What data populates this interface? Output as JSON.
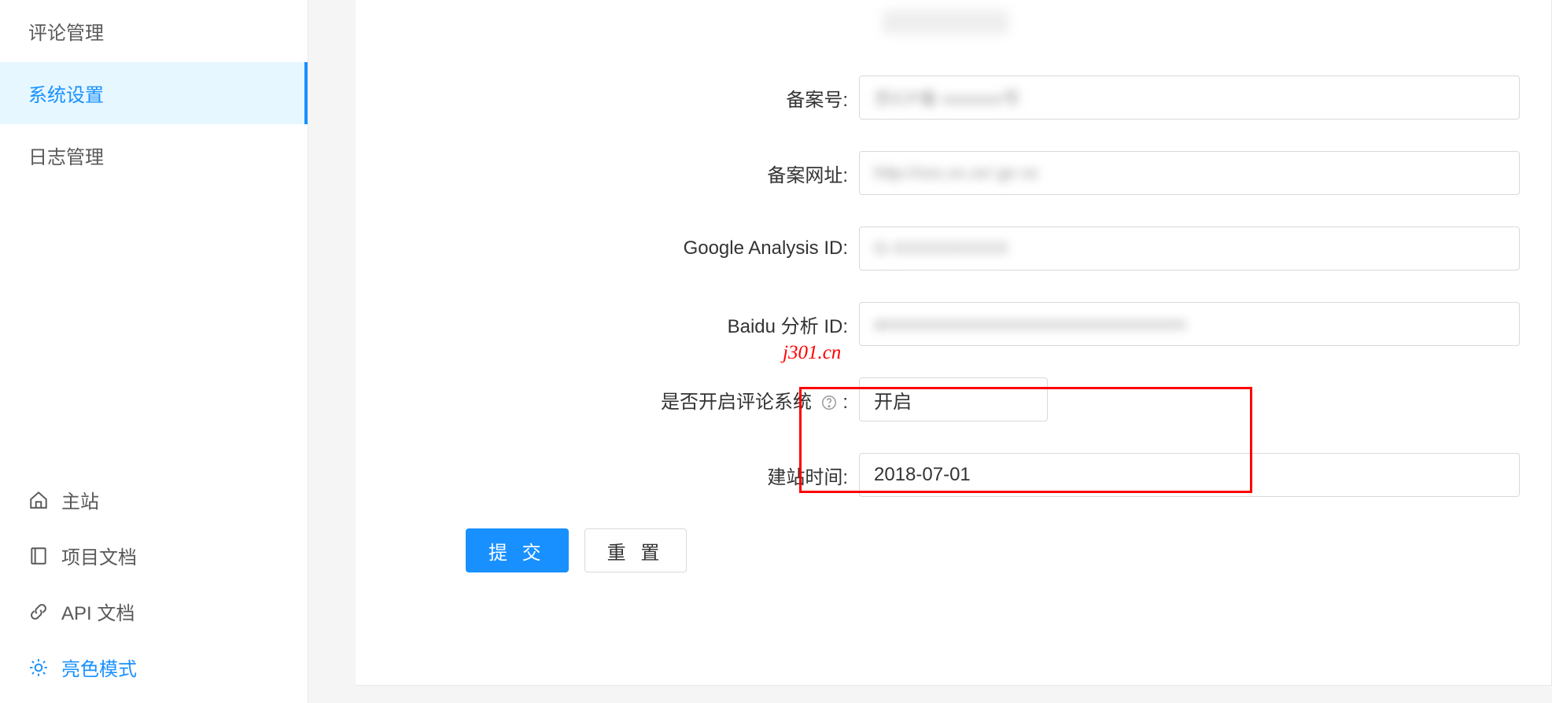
{
  "sidebar": {
    "top_items": [
      {
        "label": "评论管理",
        "key": "comments"
      },
      {
        "label": "系统设置",
        "key": "system-settings",
        "active": true
      },
      {
        "label": "日志管理",
        "key": "logs"
      }
    ],
    "bottom_items": [
      {
        "label": "主站",
        "key": "home",
        "icon": "home"
      },
      {
        "label": "项目文档",
        "key": "project-docs",
        "icon": "book"
      },
      {
        "label": "API 文档",
        "key": "api-docs",
        "icon": "api"
      },
      {
        "label": "亮色模式",
        "key": "light-mode",
        "icon": "sun"
      }
    ]
  },
  "form": {
    "icp_label": "备案号:",
    "icp_value": "",
    "icp_url_label": "备案网址:",
    "icp_url_value": "",
    "ga_label": "Google Analysis ID:",
    "ga_value": "",
    "baidu_label": "Baidu 分析 ID:",
    "baidu_value": "",
    "comment_label": "是否开启评论系统",
    "comment_label_suffix": ":",
    "comment_value": "开启",
    "site_date_label": "建站时间:",
    "site_date_value": "2018-07-01"
  },
  "buttons": {
    "submit": "提 交",
    "reset": "重 置"
  },
  "watermark": "j301.cn"
}
